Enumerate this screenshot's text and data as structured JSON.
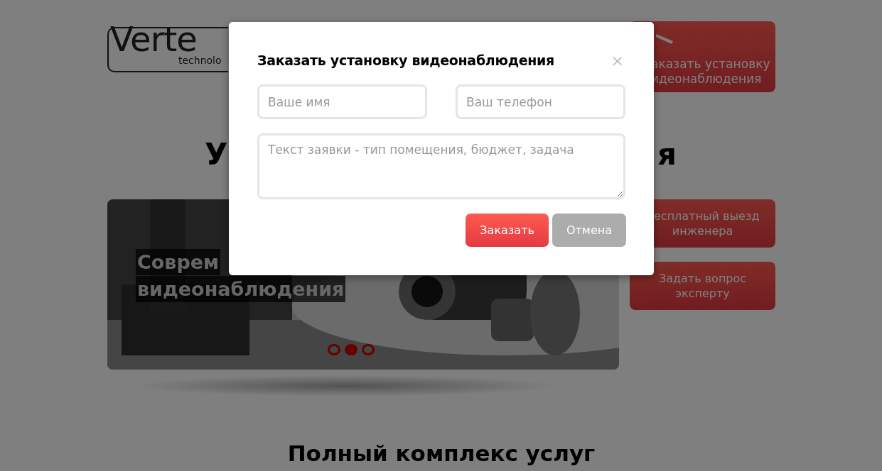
{
  "page": {
    "logo": {
      "text": "Verte",
      "subtext": "technolo"
    },
    "order_button": {
      "lines": [
        "аказать установку",
        "идеонаблюдения"
      ]
    },
    "heading_fragments": [
      "У",
      "я"
    ],
    "slider": {
      "caption_lines": [
        "Соврем",
        "видеонаблюдения"
      ],
      "dots": [
        {
          "selected": false
        },
        {
          "selected": true
        },
        {
          "selected": false
        }
      ]
    },
    "side_buttons": [
      {
        "lines": [
          "есплатный выезд",
          "инженера"
        ]
      },
      {
        "lines": [
          "Задать вопрос",
          "эксперту"
        ]
      }
    ],
    "section_heading": "Полный комплекс услуг"
  },
  "modal": {
    "title": "Заказать установку видеонаблюдения",
    "close": "×",
    "fields": [
      {
        "kind": "input",
        "placeholder": "Ваше имя"
      },
      {
        "kind": "input",
        "placeholder": "Ваш телефон"
      },
      {
        "kind": "textarea",
        "placeholder": "Текст заявки - тип помещения, бюджет, задача"
      }
    ],
    "buttons": [
      {
        "kind": "primary",
        "label": "Заказать"
      },
      {
        "kind": "secondary",
        "label": "Отмена"
      }
    ]
  }
}
